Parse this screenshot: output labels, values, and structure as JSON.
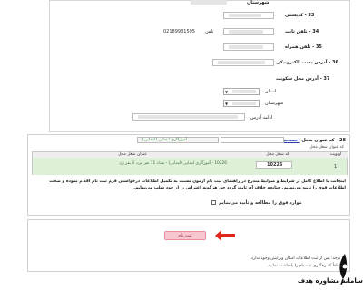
{
  "form": {
    "top_label": "شهرستان",
    "rows": [
      {
        "label": "33 - کدپستی",
        "value": ""
      },
      {
        "label": "34 - تلفن ثابت",
        "value": "02189931595",
        "extra_label": "تلفن"
      },
      {
        "label": "35 - تلفن همراه",
        "value": ""
      },
      {
        "label": "36 - آدرس پست الکترونیکی",
        "value": ""
      },
      {
        "label": "37 - آدرس محل سکونت",
        "value": ""
      }
    ],
    "province_label": "استان",
    "city_label": "شهرستان",
    "address_label": "ادامه آدرس"
  },
  "section28": {
    "title": "28 - کد عنوان شغل",
    "search_link": "(جستجو)",
    "job_value": "آموزگاری ابتدایی (ابتدایی)",
    "sub_label": "کد عنوان شغل محل",
    "headers": [
      "اولویت",
      "کد شغل محل",
      "عنوان شغل محل"
    ],
    "row": {
      "priority": "1",
      "code": "10226",
      "description": "10226 - آموزگاری ابتدایی (ابتدایی) - تعداد 11 نفر مرد، 3 نفر زن"
    },
    "notice": "اینجانب با اطلاع کامل از شرایط و ضوابط مندرج در راهنمای ثبت نام آزمون نسبت به تکمیل اطلاعات درخواستی فرم ثبت نام اقدام نموده و صحت اطلاعات فوق را تأیید می‌نمایم. چنانچه خلاف آن ثابت گردد حق هرگونه اعتراض را از خود سلب می‌نمایم.",
    "checkbox_label": "موارد فوق را مطالعه و تأیید می‌نمایم"
  },
  "submit": {
    "button_label": "ثبت نام",
    "notes": [
      "* توجه: پس از ثبت اطلاعات امکان ویرایش وجود ندارد.",
      "* لطفاً کد رهگیری ثبت نام را یادداشت نمایید."
    ]
  },
  "watermark": {
    "text": "سامانه مشاوره هدف"
  },
  "colors": {
    "accent_row": "#dff0d8",
    "submit_button": "#f7c6cf",
    "arrow": "#e0261b",
    "link": "#2a3bb0"
  }
}
